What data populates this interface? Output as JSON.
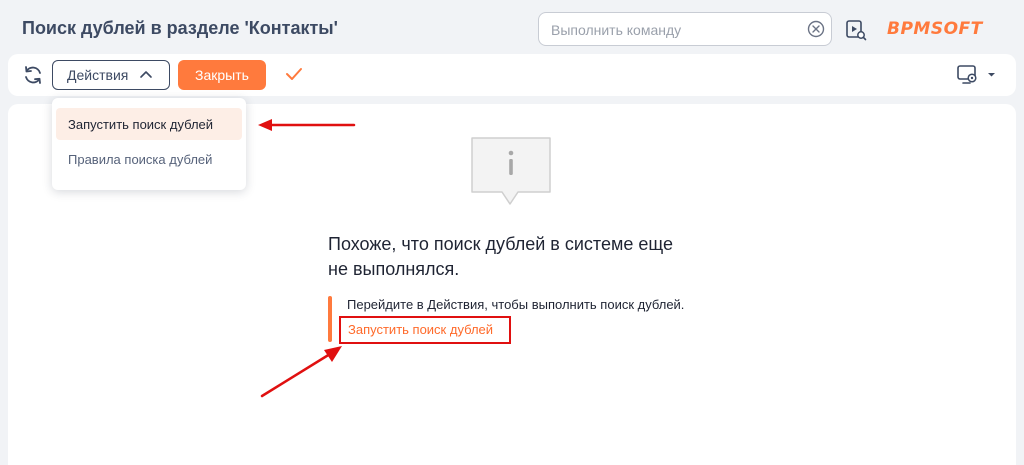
{
  "header": {
    "title": "Поиск дублей в разделе 'Контакты'",
    "search_placeholder": "Выполнить команду",
    "logo_text": "BPMSOFT"
  },
  "toolbar": {
    "actions_label": "Действия",
    "close_label": "Закрыть"
  },
  "dropdown": {
    "items": [
      {
        "label": "Запустить поиск дублей"
      },
      {
        "label": "Правила поиска дублей"
      }
    ]
  },
  "empty_state": {
    "title_line1": "Похоже, что поиск дублей в системе еще",
    "title_line2": "не выполнялся.",
    "hint_text": "Перейдите в Действия, чтобы выполнить поиск дублей.",
    "link_text": "Запустить поиск дублей"
  },
  "colors": {
    "accent": "#ff7a3d",
    "title": "#3d4a63",
    "annotation": "#e01010",
    "background": "#f1f3f6"
  }
}
